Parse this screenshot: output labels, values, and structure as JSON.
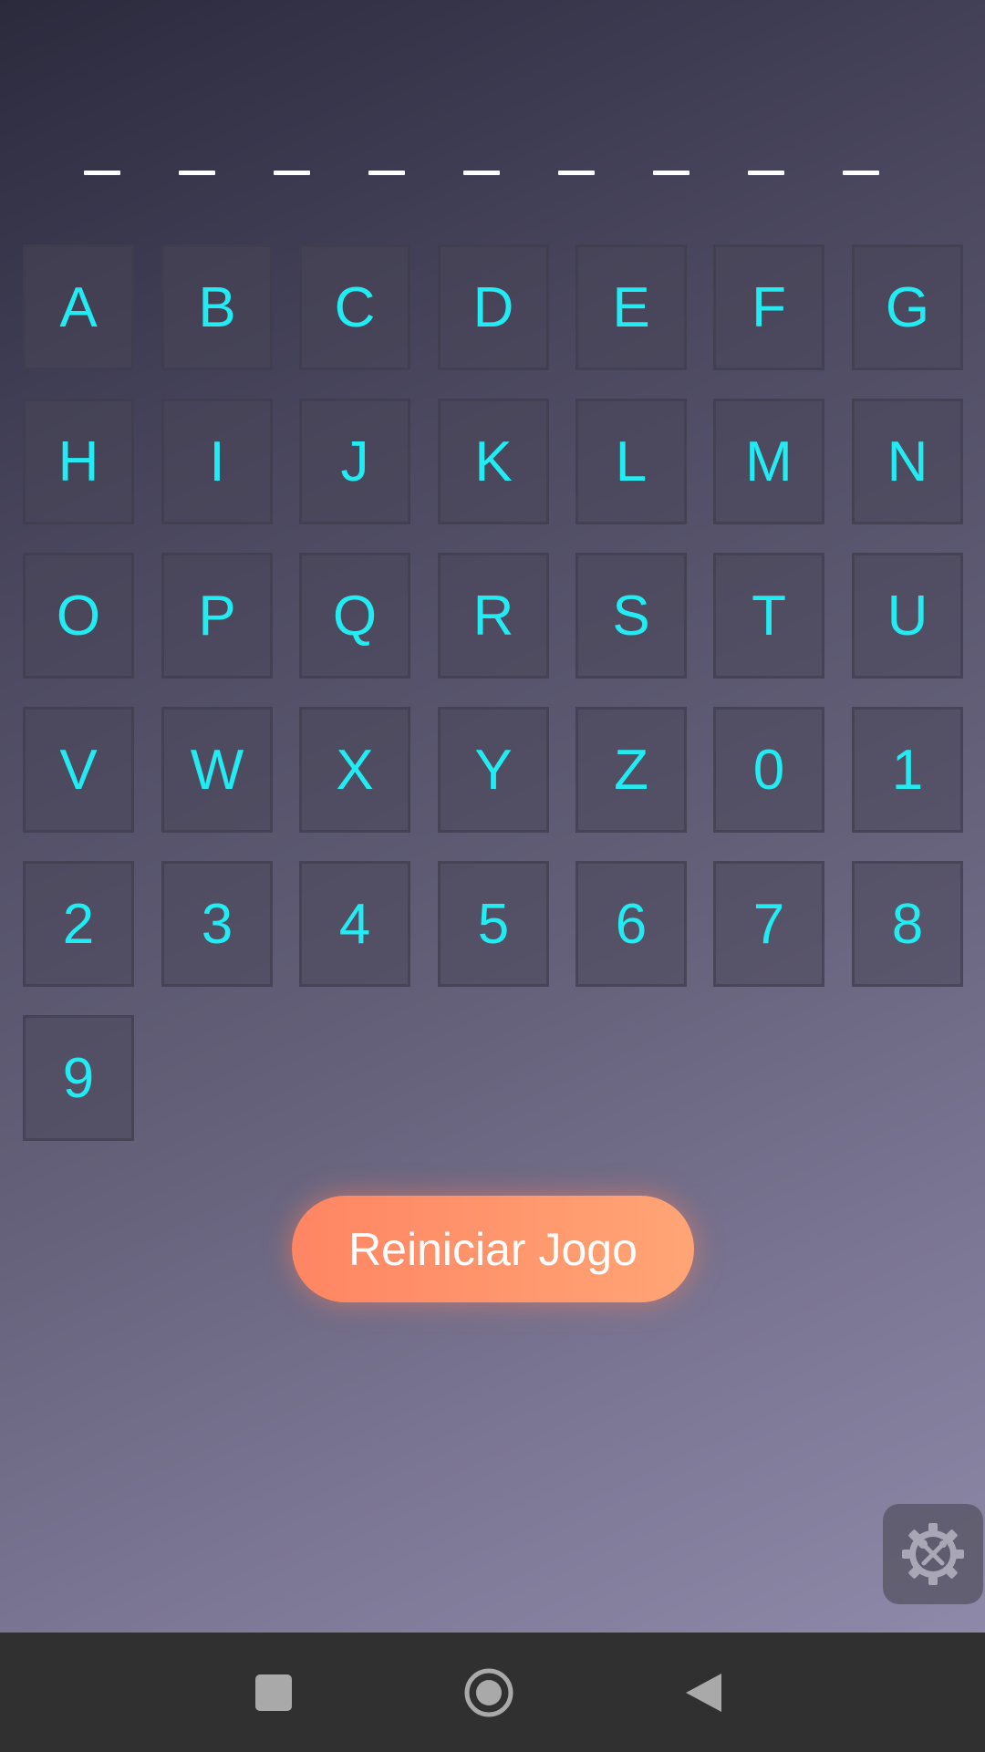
{
  "word": {
    "blanks": [
      "_",
      "_",
      "_",
      "_",
      "_",
      "_",
      "_",
      "_",
      "_"
    ]
  },
  "keys": [
    "A",
    "B",
    "C",
    "D",
    "E",
    "F",
    "G",
    "H",
    "I",
    "J",
    "K",
    "L",
    "M",
    "N",
    "O",
    "P",
    "Q",
    "R",
    "S",
    "T",
    "U",
    "V",
    "W",
    "X",
    "Y",
    "Z",
    "0",
    "1",
    "2",
    "3",
    "4",
    "5",
    "6",
    "7",
    "8",
    "9"
  ],
  "restart_button": {
    "label": "Reiniciar Jogo"
  },
  "settings_button": {
    "icon": "settings-tools-icon"
  },
  "navigation_bar": {
    "recent_apps_icon": "square-icon",
    "home_icon": "circle-icon",
    "back_icon": "triangle-left-icon"
  },
  "colors": {
    "key_text": "#22ecf2",
    "restart_start": "#ff8563",
    "restart_end": "#ffa575"
  }
}
